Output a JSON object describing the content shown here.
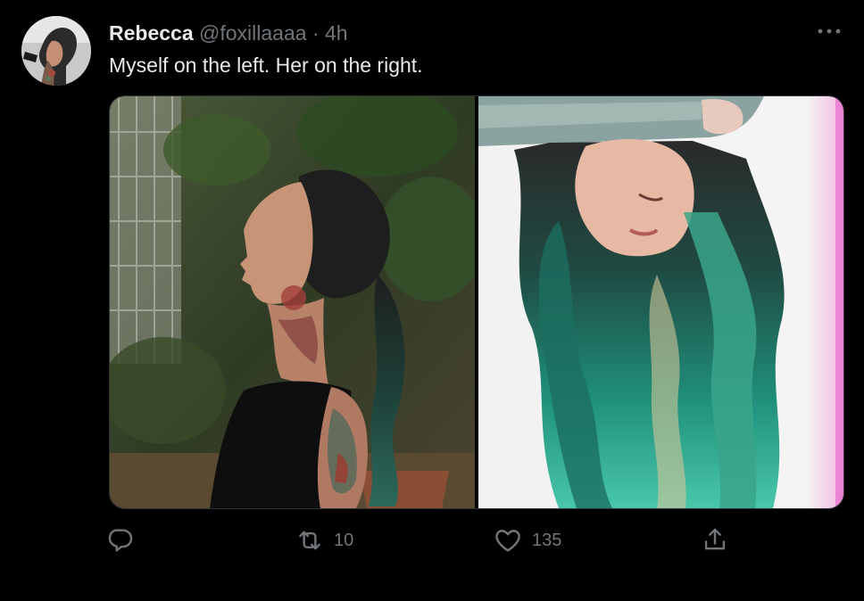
{
  "tweet": {
    "author_name": "Rebecca",
    "handle": "@foxillaaaa",
    "separator": "·",
    "time": "4h",
    "text": "Myself on the left. Her on the right."
  },
  "media": {
    "left_photo": "woman-profile-with-teal-ponytail-and-tattoos",
    "right_photo": "woman-with-long-teal-wavy-hair-and-cap"
  },
  "actions": {
    "retweet_count": "10",
    "like_count": "135"
  },
  "colors": {
    "background": "#000000",
    "text_primary": "#e7e9ea",
    "text_secondary": "#71767b",
    "border": "#2f3336"
  },
  "icons": {
    "more": "more-icon",
    "reply": "reply-icon",
    "retweet": "retweet-icon",
    "like": "heart-icon",
    "share": "share-icon"
  }
}
